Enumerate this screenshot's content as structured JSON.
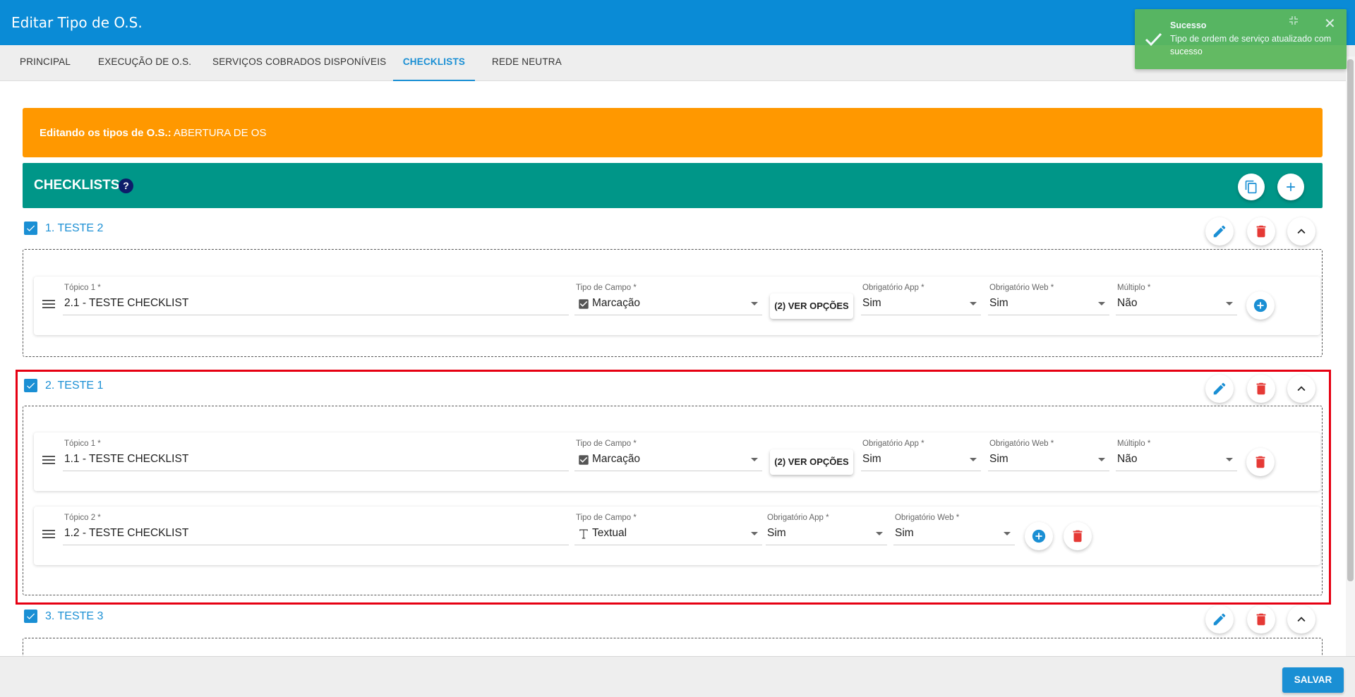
{
  "dialog": {
    "title": "Editar Tipo de O.S."
  },
  "tabs": [
    {
      "label": "PRINCIPAL"
    },
    {
      "label": "EXECUÇÃO DE O.S."
    },
    {
      "label": "SERVIÇOS COBRADOS DISPONÍVEIS"
    },
    {
      "label": "CHECKLISTS",
      "active": true
    },
    {
      "label": "REDE NEUTRA"
    }
  ],
  "notice": {
    "prefix": "Editando os tipos de O.S.:",
    "value": " ABERTURA DE OS"
  },
  "section": {
    "title": "CHECKLISTS",
    "help": "?"
  },
  "checklists": [
    {
      "title": "1. TESTE 2",
      "topics": [
        {
          "topic_label": "Tópico 1 *",
          "topic_value": "2.1 - TESTE CHECKLIST",
          "type_label": "Tipo de Campo *",
          "type_value": "Marcação",
          "options_button": "(2) VER OPÇÕES",
          "app_label": "Obrigatório App *",
          "app_value": "Sim",
          "web_label": "Obrigatório Web *",
          "web_value": "Sim",
          "multi_label": "Múltiplo *",
          "multi_value": "Não"
        }
      ]
    },
    {
      "title": "2. TESTE 1",
      "topics": [
        {
          "topic_label": "Tópico 1 *",
          "topic_value": "1.1 - TESTE CHECKLIST",
          "type_label": "Tipo de Campo *",
          "type_value": "Marcação",
          "options_button": "(2) VER OPÇÕES",
          "app_label": "Obrigatório App *",
          "app_value": "Sim",
          "web_label": "Obrigatório Web *",
          "web_value": "Sim",
          "multi_label": "Múltiplo *",
          "multi_value": "Não"
        },
        {
          "topic_label": "Tópico 2 *",
          "topic_value": "1.2 - TESTE CHECKLIST",
          "type_label": "Tipo de Campo *",
          "type_value": "Textual",
          "app_label": "Obrigatório App *",
          "app_value": "Sim",
          "web_label": "Obrigatório Web *",
          "web_value": "Sim"
        }
      ]
    },
    {
      "title": "3. TESTE 3"
    }
  ],
  "footer": {
    "save_label": "SALVAR"
  },
  "toast": {
    "title": "Sucesso",
    "message": "Tipo de ordem de serviço atualizado com sucesso"
  },
  "colors": {
    "header": "#0a8bd6",
    "accent": "#1a8fd4",
    "notice": "#ff9800",
    "section": "#009688",
    "danger": "#e53935",
    "toast": "#5cb85c",
    "highlight": "#e60012"
  }
}
